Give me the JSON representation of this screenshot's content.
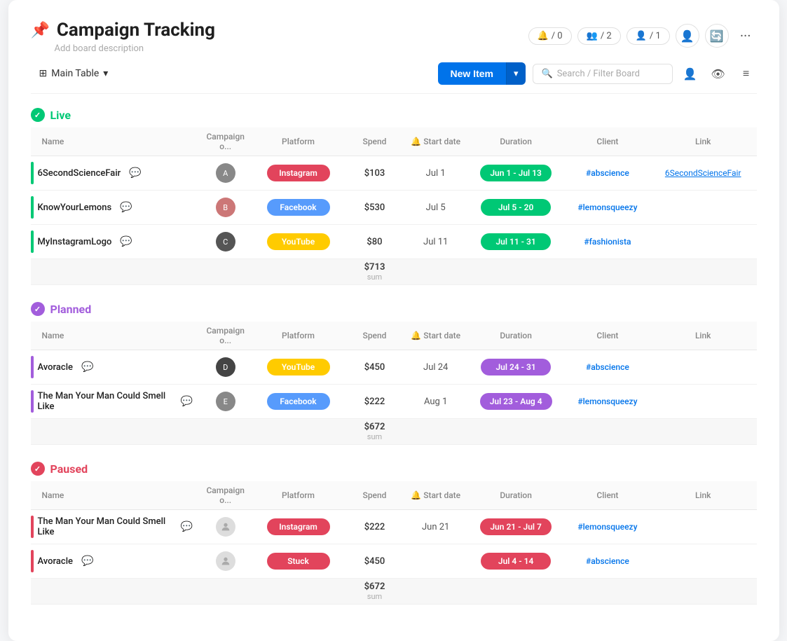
{
  "header": {
    "icon": "📌",
    "title": "Campaign Tracking",
    "subtitle": "Add board description",
    "badges": [
      {
        "icon": "🔔",
        "count": "/ 0"
      },
      {
        "icon": "👥",
        "count": "/ 2"
      },
      {
        "icon": "👤",
        "count": "/ 1"
      }
    ],
    "more_label": "···"
  },
  "toolbar": {
    "table_view_label": "Main Table",
    "new_item_label": "New Item",
    "search_placeholder": "Search / Filter Board"
  },
  "sections": [
    {
      "id": "live",
      "title": "Live",
      "status": "live",
      "color": "#00c875",
      "columns": [
        "Campaign o...",
        "Platform",
        "Spend",
        "Start date",
        "Duration",
        "Client",
        "Link"
      ],
      "rows": [
        {
          "name": "6SecondScienceFair",
          "color": "#00c875",
          "avatar_bg": "#888",
          "avatar_letter": "A",
          "platform": "Instagram",
          "platform_color": "#e2445c",
          "spend": "$103",
          "start_date": "Jul 1",
          "duration": "Jun 1 - Jul 13",
          "duration_color": "#00c875",
          "client": "#abscience",
          "link": "6SecondScienceFair"
        },
        {
          "name": "KnowYourLemons",
          "color": "#00c875",
          "avatar_bg": "#c77",
          "avatar_letter": "B",
          "platform": "Facebook",
          "platform_color": "#579bfc",
          "spend": "$530",
          "start_date": "Jul 5",
          "duration": "Jul 5 - 20",
          "duration_color": "#00c875",
          "client": "#lemonsqueezy",
          "link": ""
        },
        {
          "name": "MyInstagramLogo",
          "color": "#00c875",
          "avatar_bg": "#555",
          "avatar_letter": "C",
          "platform": "YouTube",
          "platform_color": "#ffcb00",
          "spend": "$80",
          "start_date": "Jul 11",
          "duration": "Jul 11 - 31",
          "duration_color": "#00c875",
          "client": "#fashionista",
          "link": ""
        }
      ],
      "sum": "$713"
    },
    {
      "id": "planned",
      "title": "Planned",
      "status": "planned",
      "color": "#a25ddc",
      "columns": [
        "Campaign o...",
        "Platform",
        "Spend",
        "Start date",
        "Duration",
        "Client",
        "Link"
      ],
      "rows": [
        {
          "name": "Avoracle",
          "color": "#a25ddc",
          "avatar_bg": "#444",
          "avatar_letter": "D",
          "platform": "YouTube",
          "platform_color": "#ffcb00",
          "spend": "$450",
          "start_date": "Jul 24",
          "duration": "Jul 24 - 31",
          "duration_color": "#a25ddc",
          "client": "#abscience",
          "link": ""
        },
        {
          "name": "The Man Your Man Could Smell Like",
          "color": "#a25ddc",
          "avatar_bg": "#888",
          "avatar_letter": "E",
          "platform": "Facebook",
          "platform_color": "#579bfc",
          "spend": "$222",
          "start_date": "Aug 1",
          "duration": "Jul 23 - Aug 4",
          "duration_color": "#a25ddc",
          "client": "#lemonsqueezy",
          "link": ""
        }
      ],
      "sum": "$672"
    },
    {
      "id": "paused",
      "title": "Paused",
      "status": "paused",
      "color": "#e2445c",
      "columns": [
        "Campaign o...",
        "Platform",
        "Spend",
        "Start date",
        "Duration",
        "Client",
        "Link"
      ],
      "rows": [
        {
          "name": "The Man Your Man Could Smell Like",
          "color": "#e2445c",
          "avatar_bg": "#ddd",
          "avatar_letter": "?",
          "platform": "Instagram",
          "platform_color": "#e2445c",
          "spend": "$222",
          "start_date": "Jun 21",
          "duration": "Jun 21 - Jul 7",
          "duration_color": "#e2445c",
          "client": "#lemonsqueezy",
          "link": ""
        },
        {
          "name": "Avoracle",
          "color": "#e2445c",
          "avatar_bg": "#ddd",
          "avatar_letter": "?",
          "platform": "Stuck",
          "platform_color": "#e2445c",
          "spend": "$450",
          "start_date": "",
          "duration": "Jul 4 - 14",
          "duration_color": "#e2445c",
          "client": "#abscience",
          "link": ""
        }
      ],
      "sum": "$672"
    }
  ]
}
